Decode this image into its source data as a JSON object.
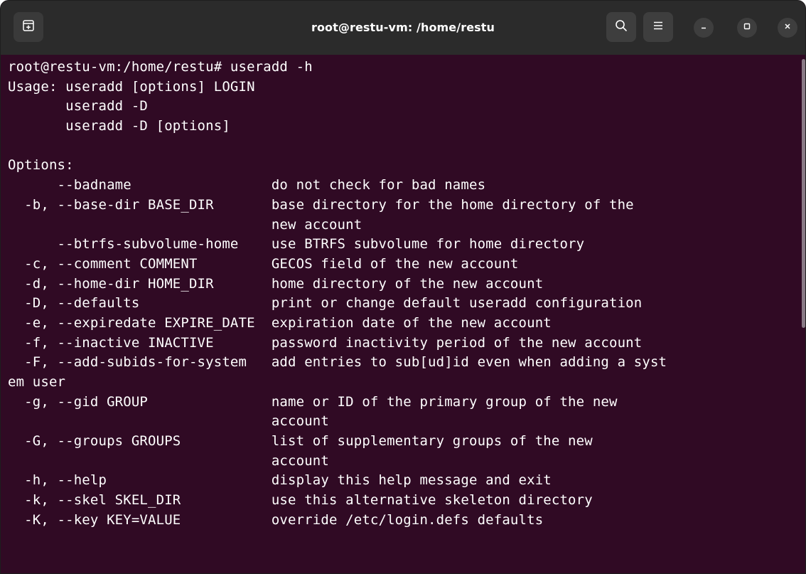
{
  "window": {
    "title": "root@restu-vm: /home/restu"
  },
  "icons": {
    "new_tab": "new-tab-icon",
    "search": "search-icon",
    "menu": "hamburger-menu-icon",
    "minimize": "minimize-icon",
    "maximize": "maximize-icon",
    "close": "close-icon"
  },
  "colors": {
    "terminal_background": "#300a24",
    "titlebar_background": "#2b2b2b",
    "text": "#ffffff"
  },
  "terminal": {
    "lines": [
      "root@restu-vm:/home/restu# useradd -h",
      "Usage: useradd [options] LOGIN",
      "       useradd -D",
      "       useradd -D [options]",
      "",
      "Options:",
      "      --badname                 do not check for bad names",
      "  -b, --base-dir BASE_DIR       base directory for the home directory of the",
      "                                new account",
      "      --btrfs-subvolume-home    use BTRFS subvolume for home directory",
      "  -c, --comment COMMENT         GECOS field of the new account",
      "  -d, --home-dir HOME_DIR       home directory of the new account",
      "  -D, --defaults                print or change default useradd configuration",
      "  -e, --expiredate EXPIRE_DATE  expiration date of the new account",
      "  -f, --inactive INACTIVE       password inactivity period of the new account",
      "  -F, --add-subids-for-system   add entries to sub[ud]id even when adding a syst",
      "em user",
      "  -g, --gid GROUP               name or ID of the primary group of the new",
      "                                account",
      "  -G, --groups GROUPS           list of supplementary groups of the new",
      "                                account",
      "  -h, --help                    display this help message and exit",
      "  -k, --skel SKEL_DIR           use this alternative skeleton directory",
      "  -K, --key KEY=VALUE           override /etc/login.defs defaults"
    ]
  }
}
